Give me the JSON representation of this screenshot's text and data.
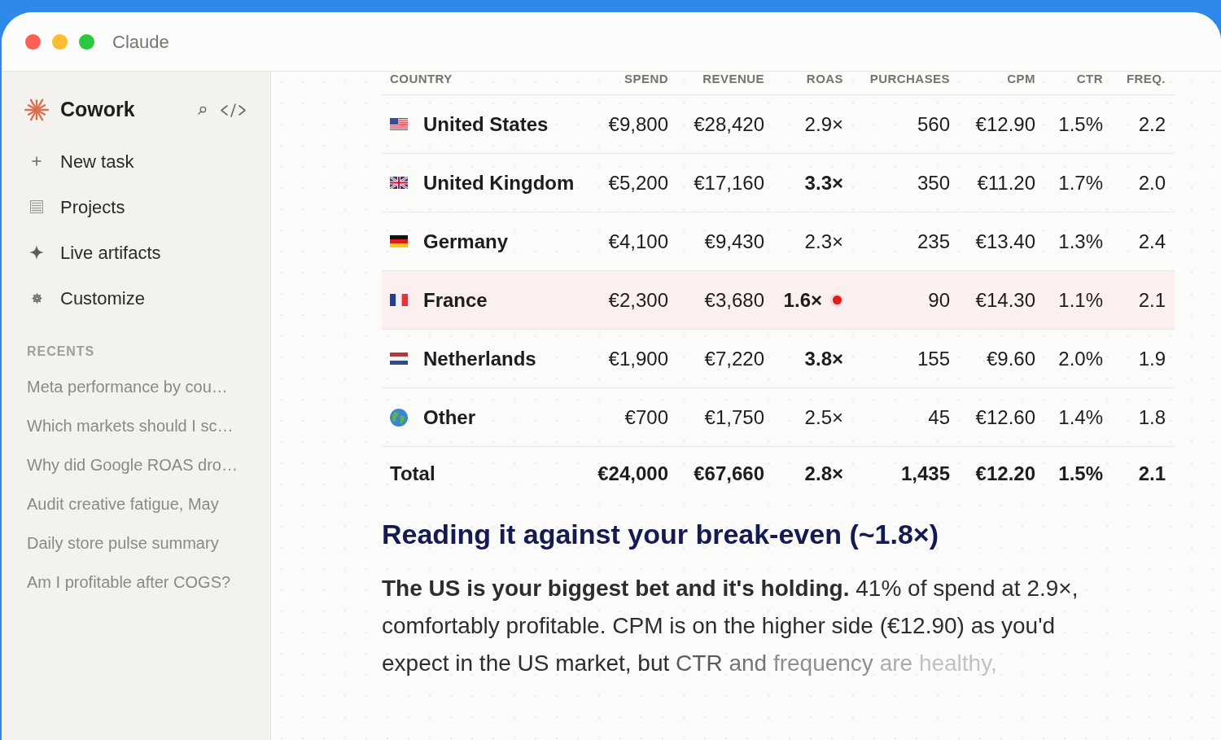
{
  "window": {
    "title": "Claude"
  },
  "sidebar": {
    "brand": "Cowork",
    "nav": [
      {
        "label": "New task"
      },
      {
        "label": "Projects"
      },
      {
        "label": "Live artifacts"
      },
      {
        "label": "Customize"
      }
    ],
    "recents_heading": "RECENTS",
    "recents": [
      "Meta performance by cou…",
      "Which markets should I sc…",
      "Why did Google ROAS dro…",
      "Audit creative fatigue, May",
      "Daily store pulse summary",
      "Am I profitable after COGS?"
    ]
  },
  "table": {
    "columns": [
      "COUNTRY",
      "SPEND",
      "REVENUE",
      "ROAS",
      "PURCHASES",
      "CPM",
      "CTR",
      "FREQ."
    ],
    "rows": [
      {
        "country": "United States",
        "spend": "€9,800",
        "revenue": "€28,420",
        "roas": "2.9×",
        "roas_bold": false,
        "purchases": "560",
        "cpm": "€12.90",
        "ctr": "1.5%",
        "freq": "2.2",
        "flagged": false
      },
      {
        "country": "United Kingdom",
        "spend": "€5,200",
        "revenue": "€17,160",
        "roas": "3.3×",
        "roas_bold": true,
        "purchases": "350",
        "cpm": "€11.20",
        "ctr": "1.7%",
        "freq": "2.0",
        "flagged": false
      },
      {
        "country": "Germany",
        "spend": "€4,100",
        "revenue": "€9,430",
        "roas": "2.3×",
        "roas_bold": false,
        "purchases": "235",
        "cpm": "€13.40",
        "ctr": "1.3%",
        "freq": "2.4",
        "flagged": false
      },
      {
        "country": "France",
        "spend": "€2,300",
        "revenue": "€3,680",
        "roas": "1.6×",
        "roas_bold": true,
        "purchases": "90",
        "cpm": "€14.30",
        "ctr": "1.1%",
        "freq": "2.1",
        "flagged": true
      },
      {
        "country": "Netherlands",
        "spend": "€1,900",
        "revenue": "€7,220",
        "roas": "3.8×",
        "roas_bold": true,
        "purchases": "155",
        "cpm": "€9.60",
        "ctr": "2.0%",
        "freq": "1.9",
        "flagged": false
      },
      {
        "country": "Other",
        "spend": "€700",
        "revenue": "€1,750",
        "roas": "2.5×",
        "roas_bold": false,
        "purchases": "45",
        "cpm": "€12.60",
        "ctr": "1.4%",
        "freq": "1.8",
        "flagged": false
      }
    ],
    "total": {
      "country": "Total",
      "spend": "€24,000",
      "revenue": "€67,660",
      "roas": "2.8×",
      "purchases": "1,435",
      "cpm": "€12.20",
      "ctr": "1.5%",
      "freq": "2.1"
    }
  },
  "article": {
    "heading": "Reading it against your break-even (~1.8×)",
    "paragraph": "**The US is your biggest bet and it's holding.** 41% of spend at 2.9×, comfortably profitable. CPM is on the higher side (€12.90) as you'd expect in the US market, but",
    "fading_text": "CTR and frequency are healthy,"
  }
}
